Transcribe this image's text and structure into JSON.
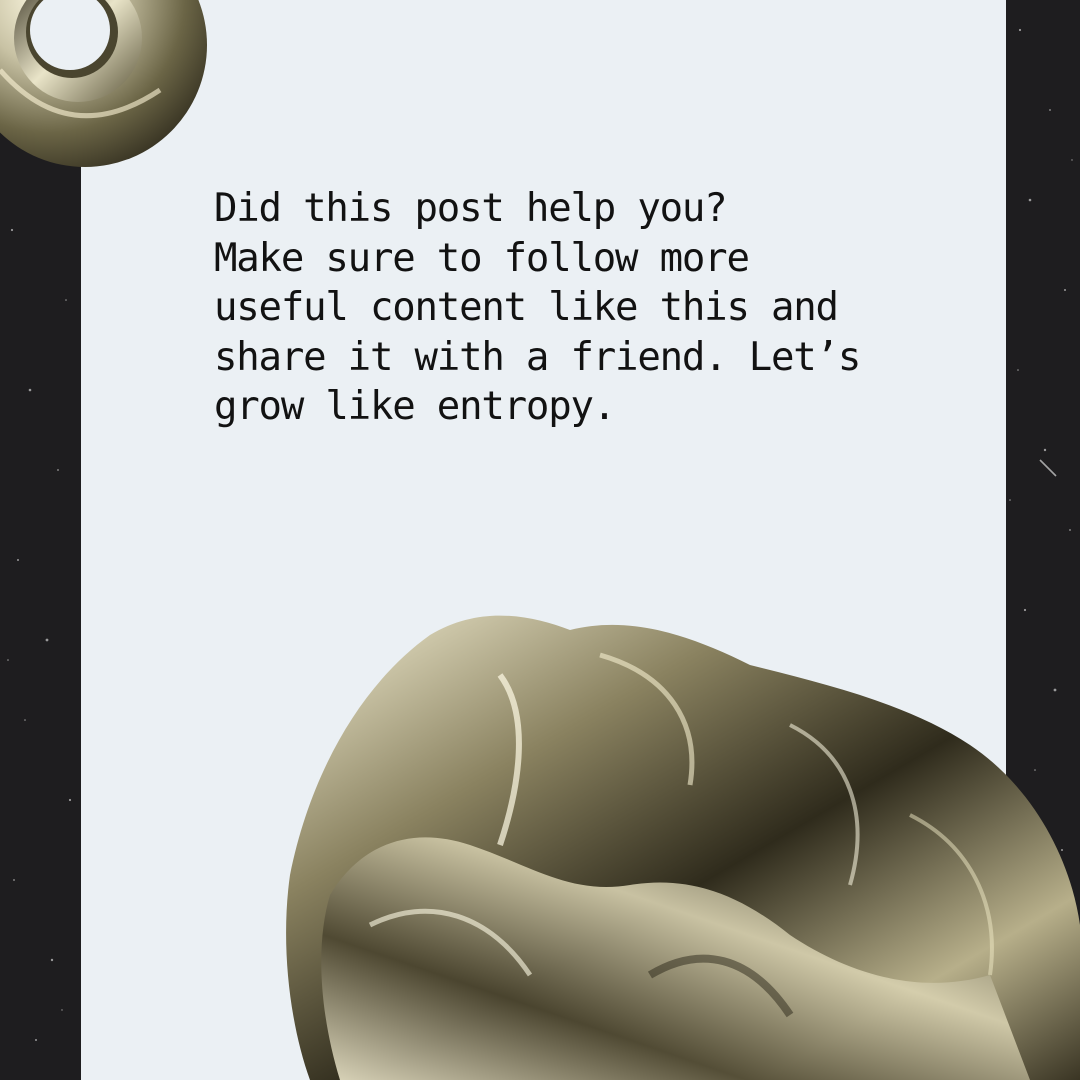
{
  "post": {
    "message": "Did this post help you?\nMake sure to follow more\nuseful content like this and\nshare it with a friend. Let’s\ngrow like entropy."
  },
  "palette": {
    "background": "#1e1d1f",
    "panel": "#ebf0f4",
    "text": "#121212",
    "metal": "#c8c2a4"
  }
}
